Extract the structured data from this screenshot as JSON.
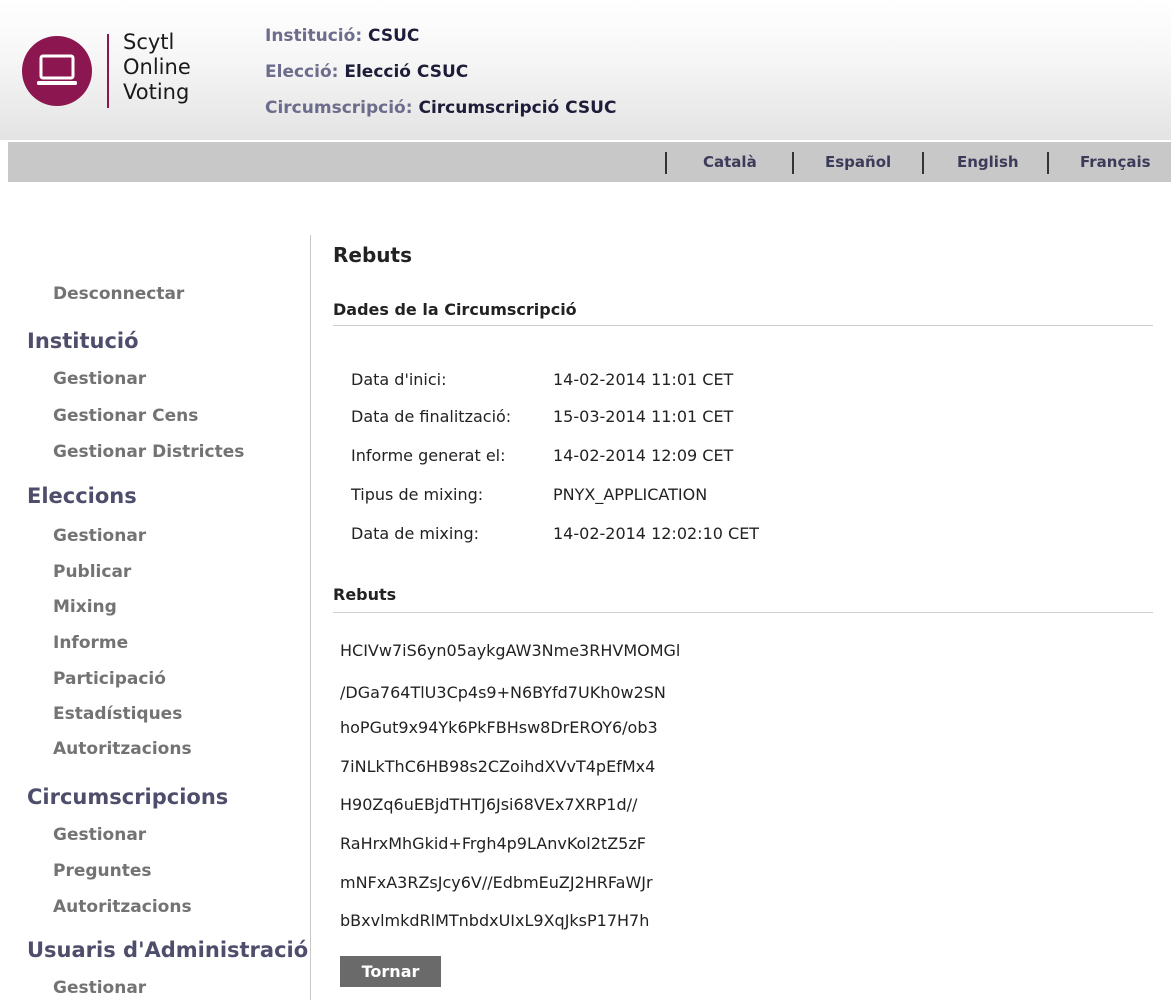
{
  "logo": {
    "line1": "Scytl",
    "line2": "Online",
    "line3": "Voting"
  },
  "header": {
    "institution_label": "Institució:",
    "institution_value": "CSUC",
    "election_label": "Elecció:",
    "election_value": "Elecció CSUC",
    "district_label": "Circumscripció:",
    "district_value": "Circumscripció CSUC"
  },
  "languages": [
    "Català",
    "Español",
    "English",
    "Français"
  ],
  "sidebar": {
    "logout": "Desconnectar",
    "institution": {
      "heading": "Institució",
      "items": [
        "Gestionar",
        "Gestionar Cens",
        "Gestionar Districtes"
      ]
    },
    "elections": {
      "heading": "Eleccions",
      "items": [
        "Gestionar",
        "Publicar",
        "Mixing",
        "Informe",
        "Participació",
        "Estadístiques",
        "Autoritzacions"
      ]
    },
    "districts": {
      "heading": "Circumscripcions",
      "items": [
        "Gestionar",
        "Preguntes",
        "Autoritzacions"
      ]
    },
    "admin_users": {
      "heading": "Usuaris d'Administració",
      "items": [
        "Gestionar"
      ]
    }
  },
  "main": {
    "title": "Rebuts",
    "district_data_title": "Dades de la Circumscripció",
    "details": [
      {
        "label": "Data d'inici:",
        "value": "14-02-2014 11:01 CET"
      },
      {
        "label": "Data de finalització:",
        "value": "15-03-2014 11:01 CET"
      },
      {
        "label": "Informe generat el:",
        "value": "14-02-2014 12:09 CET"
      },
      {
        "label": "Tipus de mixing:",
        "value": "PNYX_APPLICATION"
      },
      {
        "label": "Data de mixing:",
        "value": "14-02-2014 12:02:10 CET"
      }
    ],
    "receipts_title": "Rebuts",
    "receipts": [
      "HCIVw7iS6yn05aykgAW3Nme3RHVMOMGl",
      "/DGa764TlU3Cp4s9+N6BYfd7UKh0w2SN",
      "hoPGut9x94Yk6PkFBHsw8DrEROY6/ob3",
      "7iNLkThC6HB98s2CZoihdXVvT4pEfMx4",
      "H90Zq6uEBjdTHTJ6Jsi68VEx7XRP1d//",
      "RaHrxMhGkid+Frgh4p9LAnvKol2tZ5zF",
      "mNFxA3RZsJcy6V//EdbmEuZJ2HRFaWJr",
      "bBxvlmkdRlMTnbdxUIxL9XqJksP17H7h"
    ],
    "back_button": "Tornar"
  }
}
